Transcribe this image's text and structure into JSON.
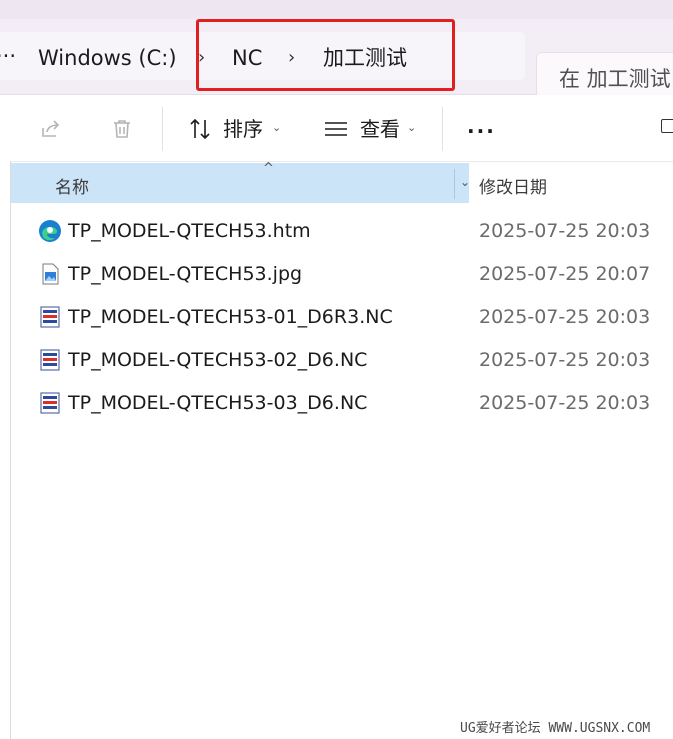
{
  "breadcrumb": {
    "overflow": "···",
    "items": [
      "Windows  (C:)",
      "NC",
      "加工测试"
    ],
    "separator": "›"
  },
  "search": {
    "placeholder": "在 加工测试"
  },
  "toolbar": {
    "sort_label": "排序",
    "view_label": "查看",
    "more_label": "···"
  },
  "columns": {
    "name": "名称",
    "date_modified": "修改日期"
  },
  "files": [
    {
      "name": "TP_MODEL-QTECH53.htm",
      "date": "2025-07-25 20:03",
      "icon": "edge-html-icon"
    },
    {
      "name": "TP_MODEL-QTECH53.jpg",
      "date": "2025-07-25 20:07",
      "icon": "image-file-icon"
    },
    {
      "name": "TP_MODEL-QTECH53-01_D6R3.NC",
      "date": "2025-07-25 20:03",
      "icon": "nc-file-icon"
    },
    {
      "name": "TP_MODEL-QTECH53-02_D6.NC",
      "date": "2025-07-25 20:03",
      "icon": "nc-file-icon"
    },
    {
      "name": "TP_MODEL-QTECH53-03_D6.NC",
      "date": "2025-07-25 20:03",
      "icon": "nc-file-icon"
    }
  ],
  "watermark": "UG爱好者论坛 WWW.UGSNX.COM",
  "colors": {
    "highlight": "#e02020",
    "header_selected": "#cce4f7",
    "address_bg": "#f3eef6"
  }
}
